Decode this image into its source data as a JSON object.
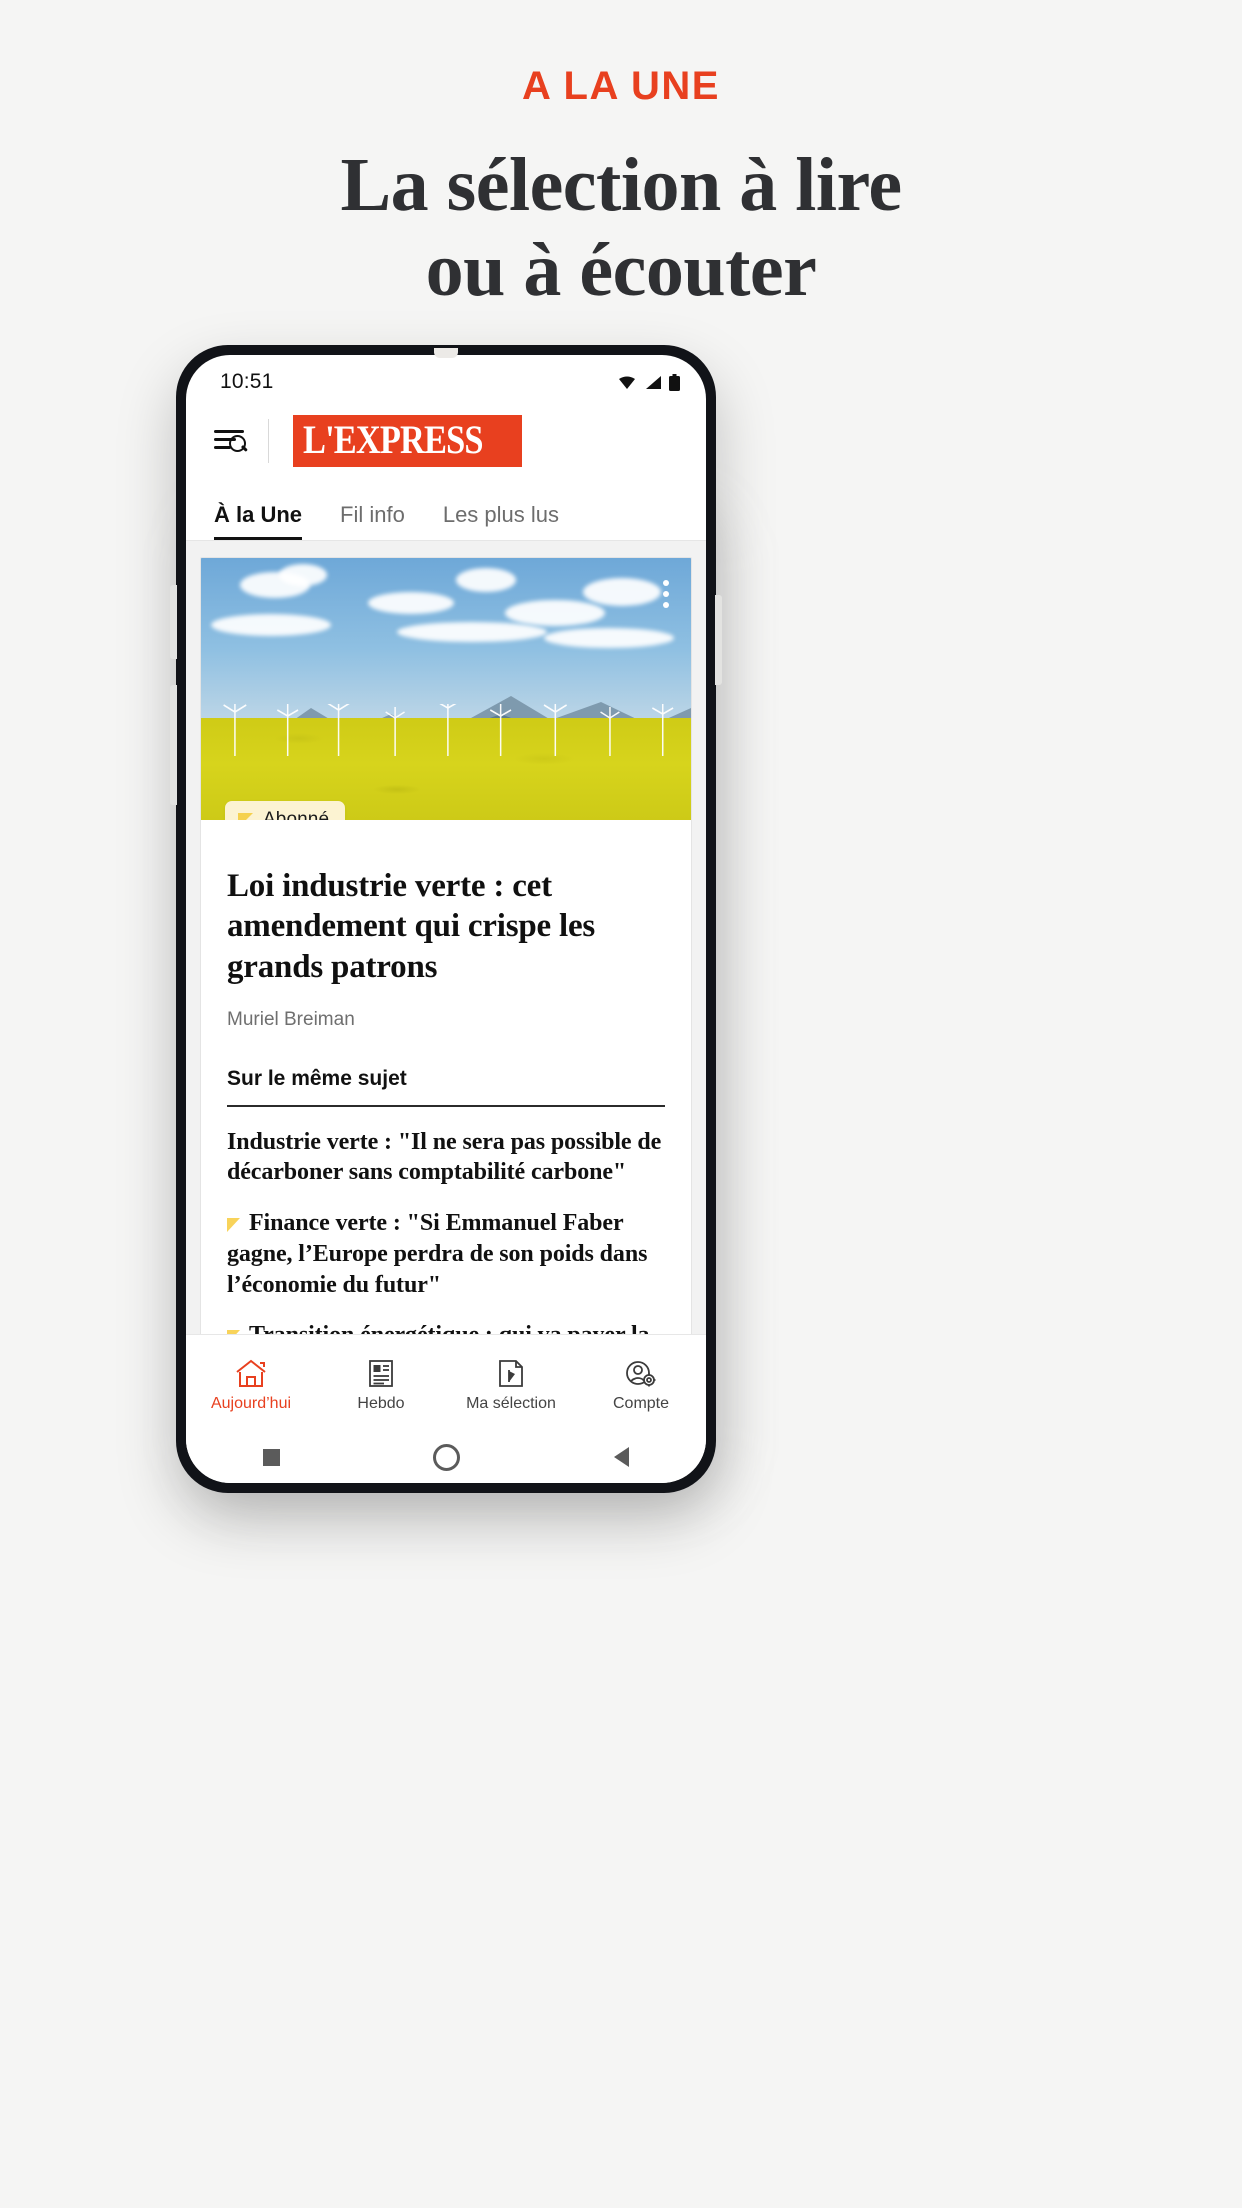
{
  "promo": {
    "kicker": "A LA UNE",
    "title_line1": "La sélection à lire",
    "title_line2": "ou à écouter",
    "accent_color": "#e8401f",
    "title_color": "#2f3033"
  },
  "phone": {
    "statusbar": {
      "time": "10:51",
      "icons": [
        "wifi-icon",
        "signal-icon",
        "battery-icon"
      ]
    },
    "header": {
      "menu_search_icon": "menu-search-icon",
      "logo_text": "L'EXPRESS",
      "logo_bg": "#e8401f"
    },
    "tabs": [
      {
        "label": "À la Une",
        "active": true
      },
      {
        "label": "Fil info",
        "active": false
      },
      {
        "label": "Les plus lus",
        "active": false
      }
    ],
    "card": {
      "more_icon": "kebab-menu-icon",
      "badge": {
        "label": "Abonné",
        "icon": "premium-triangle-icon",
        "bg": "#fcf3d2",
        "triangle_color": "#f5d14e"
      },
      "title": "Loi industrie verte : cet amendement qui crispe les grands patrons",
      "author": "Muriel Breiman",
      "related_heading": "Sur le même sujet",
      "related": [
        {
          "text": "Industrie verte : \"Il ne sera pas possible de décarboner sans comptabilité carbone\"",
          "premium": false
        },
        {
          "text": "Finance verte : \"Si Emmanuel Faber gagne, l’Europe perdra de son poids dans l’économie du futur\"",
          "premium": true
        },
        {
          "text": "Transition énergétique : qui va payer la facture ?",
          "premium": true
        }
      ]
    },
    "bottomnav": [
      {
        "label": "Aujourd’hui",
        "icon": "home-icon",
        "active": true
      },
      {
        "label": "Hebdo",
        "icon": "newspaper-icon",
        "active": false
      },
      {
        "label": "Ma sélection",
        "icon": "bookmark-pin-icon",
        "active": false
      },
      {
        "label": "Compte",
        "icon": "account-gear-icon",
        "active": false
      }
    ],
    "sysbar": [
      "square-recents-icon",
      "circle-home-icon",
      "triangle-back-icon"
    ]
  }
}
